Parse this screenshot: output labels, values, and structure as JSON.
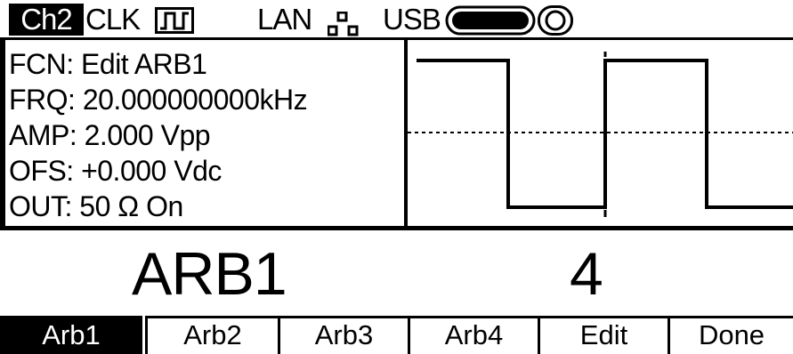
{
  "status_bar": {
    "channel": "Ch2",
    "clock_label": "CLK",
    "clock_icon": "square-wave-icon",
    "lan_label": "LAN",
    "lan_icon": "network-icon",
    "usb_label": "USB",
    "usb_icon": "usb-drive-icon",
    "record_icon": "circle-icon"
  },
  "parameters": {
    "fcn": "FCN: Edit ARB1",
    "frq": "FRQ: 20.000000000kHz",
    "amp": "AMP: 2.000 Vpp",
    "ofs": "OFS: +0.000 Vdc",
    "out": "OUT: 50 Ω On"
  },
  "waveform": {
    "type": "square",
    "icon": "square-wave-preview"
  },
  "edit_display": {
    "waveform_name": "ARB1",
    "value": "4"
  },
  "softkeys": [
    {
      "label": "Arb1",
      "active": true
    },
    {
      "label": "Arb2",
      "active": false
    },
    {
      "label": "Arb3",
      "active": false
    },
    {
      "label": "Arb4",
      "active": false
    },
    {
      "label": "Edit",
      "active": false
    },
    {
      "label": "Done",
      "active": false
    }
  ]
}
